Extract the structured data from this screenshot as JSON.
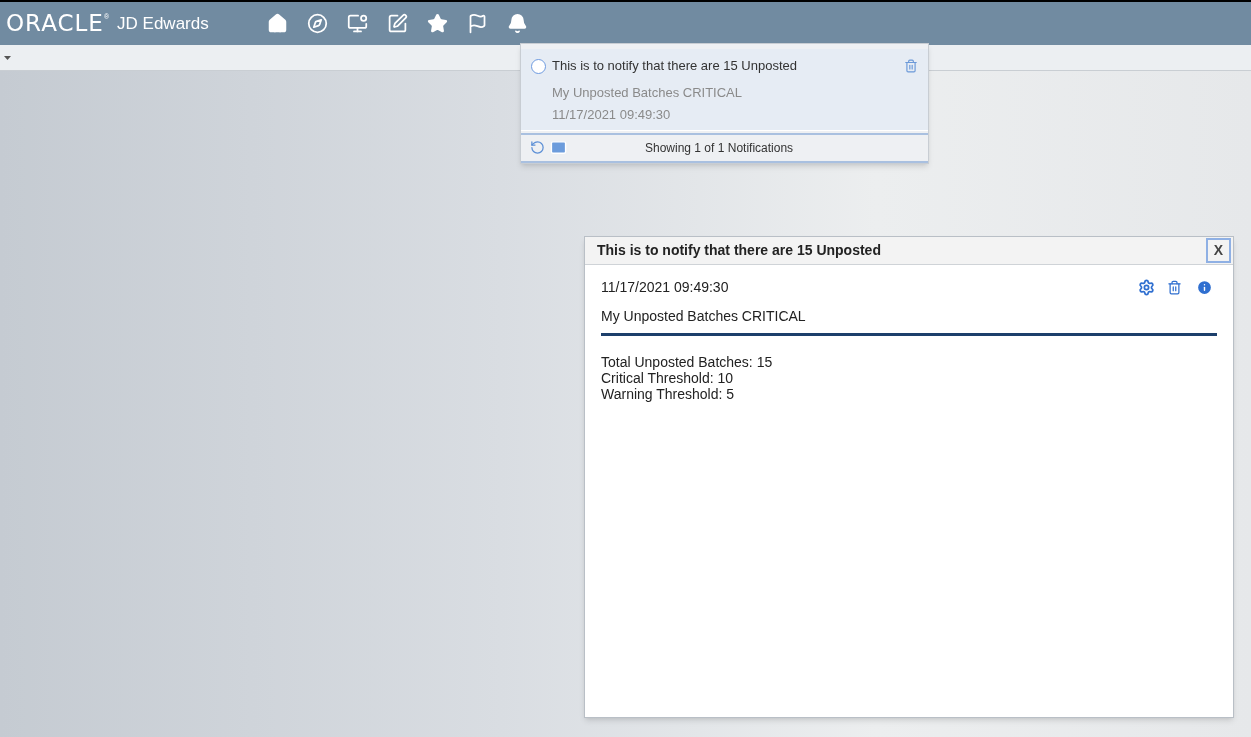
{
  "header": {
    "logo": "ORACLE",
    "logo_mark": "®",
    "product": "JD Edwards",
    "nav_icons": [
      {
        "kind": "home"
      },
      {
        "kind": "compass"
      },
      {
        "kind": "monitor"
      },
      {
        "kind": "edit"
      },
      {
        "kind": "star"
      },
      {
        "kind": "flag"
      },
      {
        "kind": "bell"
      }
    ]
  },
  "notifications_popup": {
    "items": [
      {
        "title": "This is to notify that there are 15 Unposted",
        "subtitle": "My Unposted Batches CRITICAL",
        "time": "11/17/2021 09:49:30",
        "selected": false
      }
    ],
    "footer": "Showing 1 of 1 Notifications"
  },
  "detail_dialog": {
    "title": "This is to notify that there are 15 Unposted",
    "close": "X",
    "time": "11/17/2021 09:49:30",
    "subject": "My Unposted Batches CRITICAL",
    "body_lines": [
      "Total Unposted Batches: 15",
      "Critical Threshold: 10",
      "Warning Threshold: 5"
    ]
  }
}
